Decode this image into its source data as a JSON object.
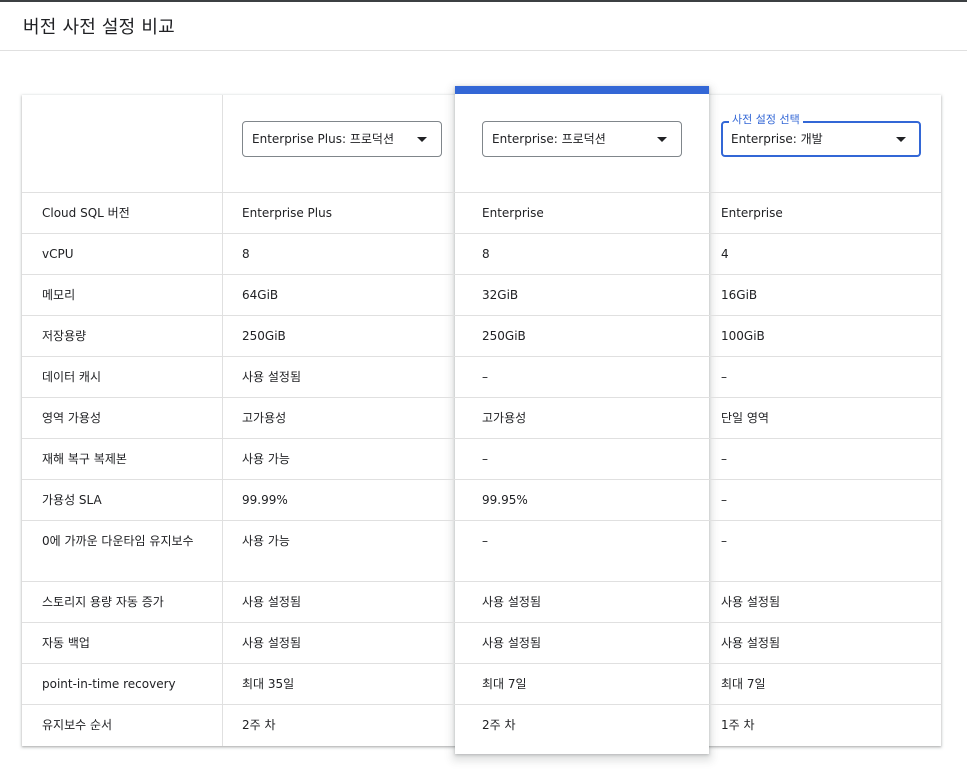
{
  "page": {
    "title": "버전 사전 설정 비교"
  },
  "colors": {
    "accent": "#3367d6",
    "border": "#e0e0e0",
    "text": "#202124"
  },
  "selects": [
    {
      "value": "Enterprise Plus: 프로덕션",
      "icon": "dropdown-arrow-icon"
    },
    {
      "value": "Enterprise: 프로덕션",
      "icon": "dropdown-arrow-icon"
    },
    {
      "value": "Enterprise: 개발",
      "floating_label": "사전 설정 선택",
      "icon": "dropdown-arrow-icon"
    }
  ],
  "rows": [
    {
      "label": "Cloud SQL 버전",
      "values": [
        "Enterprise Plus",
        "Enterprise",
        "Enterprise"
      ]
    },
    {
      "label": "vCPU",
      "values": [
        "8",
        "8",
        "4"
      ]
    },
    {
      "label": "메모리",
      "values": [
        "64GiB",
        "32GiB",
        "16GiB"
      ]
    },
    {
      "label": "저장용량",
      "values": [
        "250GiB",
        "250GiB",
        "100GiB"
      ]
    },
    {
      "label": "데이터 캐시",
      "values": [
        "사용 설정됨",
        "–",
        "–"
      ]
    },
    {
      "label": "영역 가용성",
      "values": [
        "고가용성",
        "고가용성",
        "단일 영역"
      ]
    },
    {
      "label": "재해 복구 복제본",
      "values": [
        "사용 가능",
        "–",
        "–"
      ]
    },
    {
      "label": "가용성 SLA",
      "values": [
        "99.99%",
        "99.95%",
        "–"
      ]
    },
    {
      "label": "0에 가까운 다운타임 유지보수",
      "values": [
        "사용 가능",
        "–",
        "–"
      ]
    },
    {
      "label": "스토리지 용량 자동 증가",
      "values": [
        "사용 설정됨",
        "사용 설정됨",
        "사용 설정됨"
      ]
    },
    {
      "label": "자동 백업",
      "values": [
        "사용 설정됨",
        "사용 설정됨",
        "사용 설정됨"
      ]
    },
    {
      "label": "point-in-time recovery",
      "values": [
        "최대 35일",
        "최대 7일",
        "최대 7일"
      ]
    },
    {
      "label": "유지보수 순서",
      "values": [
        "2주 차",
        "2주 차",
        "1주 차"
      ]
    }
  ]
}
